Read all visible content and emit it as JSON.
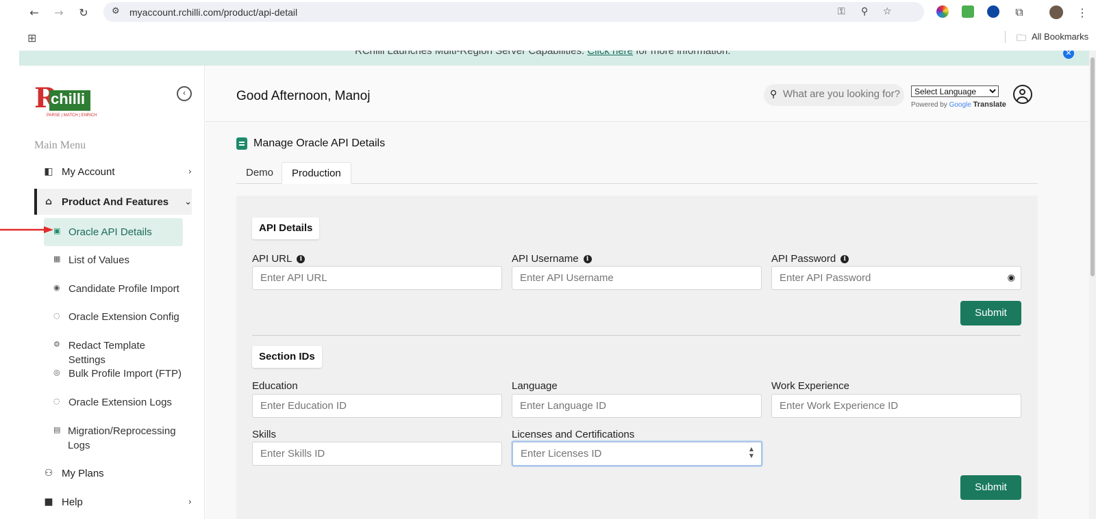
{
  "browser": {
    "url": "myaccount.rchilli.com/product/api-detail",
    "bookmarks_label": "All Bookmarks"
  },
  "announcement": {
    "text_before": "RChilli Launches Multi-Region Server Capabilities.",
    "link": "Click here",
    "text_after": "for more information."
  },
  "logo": {
    "letter": "R",
    "word": "chilli",
    "tagline": "PARSE | MATCH | ENRICH"
  },
  "sidebar": {
    "heading": "Main Menu",
    "items": [
      {
        "label": "My Account",
        "icon": "dashboard-icon"
      },
      {
        "label": "Product And Features",
        "icon": "store-icon"
      },
      {
        "label": "My Plans",
        "icon": "users-icon"
      },
      {
        "label": "Help",
        "icon": "book-icon"
      }
    ],
    "sub_items": [
      {
        "label": "Oracle API Details",
        "icon": "clipboard-icon"
      },
      {
        "label": "List of Values",
        "icon": "chart-icon"
      },
      {
        "label": "Candidate Profile Import",
        "icon": "user-circle-icon"
      },
      {
        "label": "Oracle Extension Config",
        "icon": "chat-icon"
      },
      {
        "label": "Redact Template Settings",
        "icon": "settings-icon"
      },
      {
        "label": "Bulk Profile Import (FTP)",
        "icon": "badge-icon"
      },
      {
        "label": "Oracle Extension Logs",
        "icon": "chat-icon"
      },
      {
        "label": "Migration/Reprocessing Logs",
        "icon": "database-icon"
      }
    ]
  },
  "header": {
    "greeting": "Good Afternoon, Manoj",
    "search_placeholder": "What are you looking for?",
    "language_select": "Select Language",
    "powered_by": "Powered by",
    "google": "Google",
    "translate": "Translate"
  },
  "page": {
    "title": "Manage Oracle API Details",
    "tabs": [
      "Demo",
      "Production"
    ],
    "active_tab": "Production"
  },
  "api_details": {
    "label": "API Details",
    "url_label": "API URL",
    "url_placeholder": "Enter API URL",
    "username_label": "API Username",
    "username_placeholder": "Enter API Username",
    "password_label": "API Password",
    "password_placeholder": "Enter API Password",
    "submit": "Submit"
  },
  "section_ids": {
    "label": "Section IDs",
    "education_label": "Education",
    "education_placeholder": "Enter Education ID",
    "language_label": "Language",
    "language_placeholder": "Enter Language ID",
    "work_label": "Work Experience",
    "work_placeholder": "Enter Work Experience ID",
    "skills_label": "Skills",
    "skills_placeholder": "Enter Skills ID",
    "licenses_label": "Licenses and Certifications",
    "licenses_placeholder": "Enter Licenses ID",
    "submit": "Submit"
  },
  "colors": {
    "accent": "#1b7a5e",
    "active_bg": "#dff0ea",
    "announcement_bg": "#d6ece7"
  }
}
